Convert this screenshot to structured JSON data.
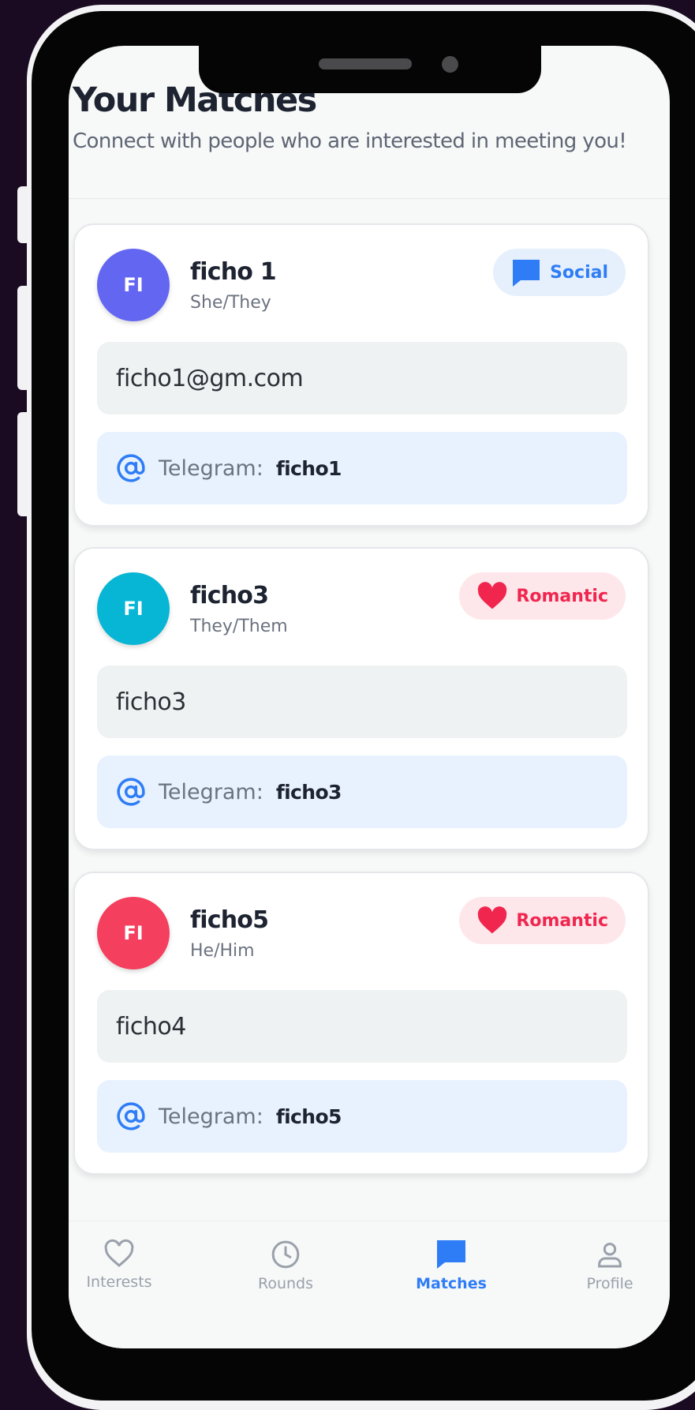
{
  "header": {
    "title": "Your Matches",
    "subtitle": "Connect with people who are interested in meeting you!"
  },
  "matches": [
    {
      "initials": "FI",
      "name": "ficho 1",
      "pronouns": "She/They",
      "badge": "Social",
      "badge_icon": "chat-bubble-icon",
      "avatar_color": "#6366f1",
      "contact": "ficho1@gm.com",
      "telegram_label": "Telegram:",
      "telegram_handle": "ficho1"
    },
    {
      "initials": "FI",
      "name": "ficho3",
      "pronouns": "They/Them",
      "badge": "Romantic",
      "badge_icon": "heart-icon",
      "avatar_color": "#06b6d4",
      "contact": "ficho3",
      "telegram_label": "Telegram:",
      "telegram_handle": "ficho3"
    },
    {
      "initials": "FI",
      "name": "ficho5",
      "pronouns": "He/Him",
      "badge": "Romantic",
      "badge_icon": "heart-icon",
      "avatar_color": "#f43f5e",
      "contact": "ficho4",
      "telegram_label": "Telegram:",
      "telegram_handle": "ficho5"
    }
  ],
  "nav": {
    "items": [
      {
        "label": "Interests",
        "icon": "heart-outline-icon",
        "active": false
      },
      {
        "label": "Rounds",
        "icon": "clock-icon",
        "active": false
      },
      {
        "label": "Matches",
        "icon": "chat-bubble-icon",
        "active": true
      },
      {
        "label": "Profile",
        "icon": "person-icon",
        "active": false
      }
    ]
  },
  "colors": {
    "accent_blue": "#2f7df6",
    "romantic_pink": "#f0264f",
    "social_bg": "#e6f0fd",
    "romantic_bg": "#fde7ea",
    "device_background": "#1b0b22"
  }
}
